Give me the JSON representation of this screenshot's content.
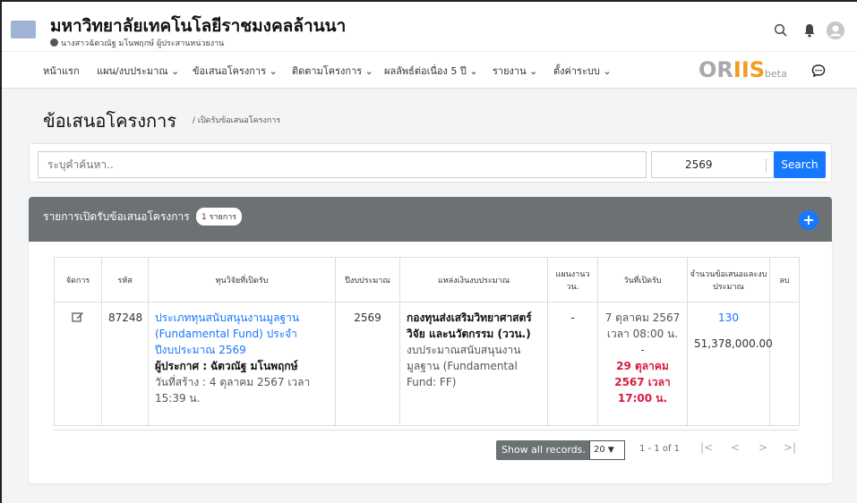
{
  "header": {
    "university_name": "มหาวิทยาลัยเทคโนโลยีราชมงคลล้านนา",
    "user_line": "นางสาวฉัตวณัฐ มโนพฤกษ์ ผู้ประสานหน่วยงาน"
  },
  "nav": {
    "items": [
      {
        "label": "หน้าแรก"
      },
      {
        "label": "แผน/งบประมาณ ⌄"
      },
      {
        "label": "ข้อเสนอโครงการ ⌄"
      },
      {
        "label": "ติดตามโครงการ ⌄"
      },
      {
        "label": "ผลลัพธ์ต่อเนื่อง 5 ปี ⌄"
      },
      {
        "label": "รายงาน ⌄"
      },
      {
        "label": "ตั้งค่าระบบ ⌄"
      }
    ],
    "brand_part1": "OR",
    "brand_part2": "IIS",
    "brand_suffix": "beta"
  },
  "page": {
    "title": "ข้อเสนอโครงการ",
    "breadcrumb": "/ เปิดรับข้อเสนอโครงการ"
  },
  "search": {
    "placeholder": "ระบุคำค้นหา..",
    "year_value": "2569",
    "button_label": "Search"
  },
  "panel": {
    "title": "รายการเปิดรับข้อเสนอโครงการ",
    "count_badge": "1 รายการ",
    "add_label": "+"
  },
  "table": {
    "headers": [
      "จัดการ",
      "รหัส",
      "ทุนวิจัยที่เปิดรับ",
      "ปีงบประมาณ",
      "แหล่งเงินงบประมาณ",
      "แผนงานววน.",
      "วันที่เปิดรับ",
      "จำนวนข้อเสนอและงบประมาณ",
      "ลบ"
    ],
    "rows": [
      {
        "code": "87248",
        "fund_name": "ประเภททุนสนับสนุนงานมูลฐาน (Fundamental Fund) ประจำปีงบประมาณ 2569",
        "announcer_label": "ผู้ประกาศ :",
        "announcer_name": "ฉัตวณัฐ มโนพฤกษ์",
        "created": "วันที่สร้าง : 4 ตุลาคม 2567 เวลา 15:39 น.",
        "fiscal_year": "2569",
        "source_main": "กองทุนส่งเสริมวิทยาศาสตร์ วิจัย และนวัตกรรม (ววน.)",
        "source_sub": "งบประมาณสนับสนุนงานมูลฐาน (Fundamental Fund: FF)",
        "plan": "-",
        "open_start": "7 ตุลาคม 2567 เวลา 08:00 น.",
        "open_dash": "-",
        "open_end": "29 ตุลาคม 2567 เวลา 17:00 น.",
        "proposal_count": "130",
        "budget": "51,378,000.00"
      }
    ]
  },
  "pagination": {
    "show_all": "Show all records.",
    "page_size": "20",
    "range": "1 - 1 of 1",
    "first": "|<",
    "prev": "<",
    "next": ">",
    "last": ">|"
  },
  "colors": {
    "accent": "#1677ff",
    "panel_header": "#6c7173",
    "deadline": "#d81b3c",
    "brand_grey": "#a7a9ac",
    "brand_orange": "#f39a1f"
  }
}
